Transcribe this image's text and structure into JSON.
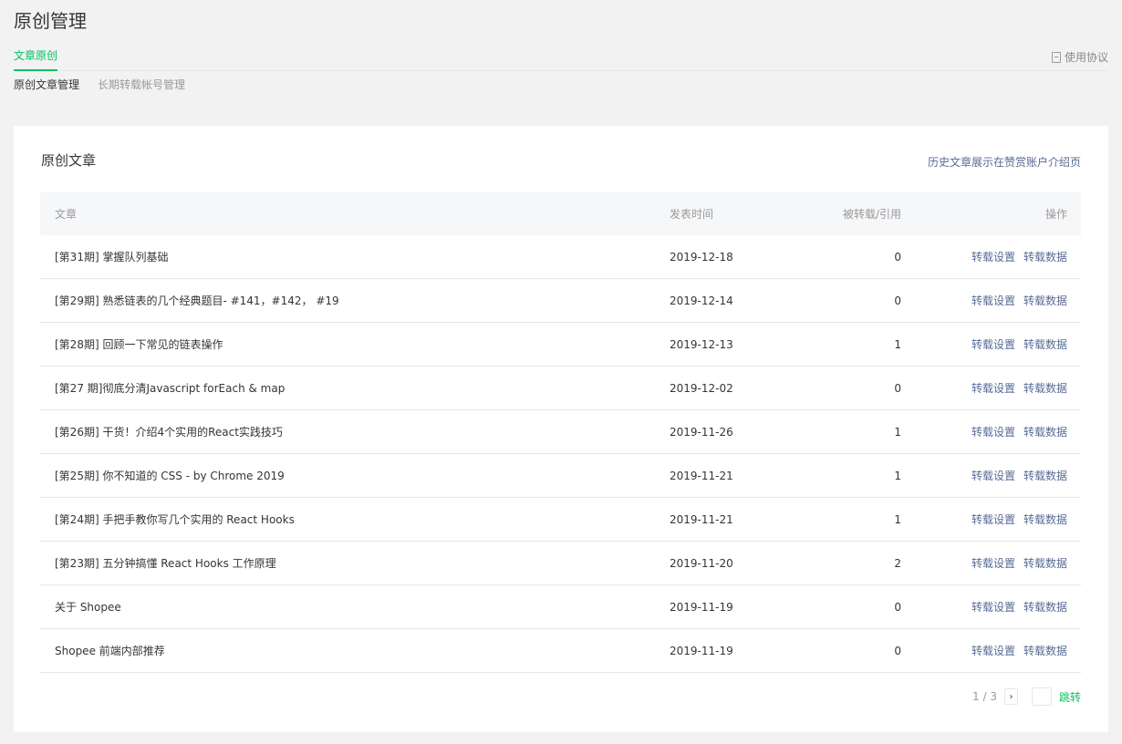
{
  "page": {
    "title": "原创管理"
  },
  "tabs": {
    "active": "文章原创",
    "agreement_link": "使用协议",
    "agreement_icon": "document-icon"
  },
  "subtabs": [
    {
      "label": "原创文章管理",
      "active": true
    },
    {
      "label": "长期转载帐号管理",
      "active": false
    }
  ],
  "card": {
    "title": "原创文章",
    "link": "历史文章展示在赞赏账户介绍页"
  },
  "table": {
    "headers": {
      "title": "文章",
      "date": "发表时间",
      "count": "被转载/引用",
      "ops": "操作"
    },
    "op_labels": {
      "settings": "转载设置",
      "data": "转载数据"
    },
    "rows": [
      {
        "title": "[第31期] 掌握队列基础",
        "date": "2019-12-18",
        "count": "0"
      },
      {
        "title": "[第29期] 熟悉链表的几个经典题目- #141，#142， #19",
        "date": "2019-12-14",
        "count": "0"
      },
      {
        "title": "[第28期] 回顾一下常见的链表操作",
        "date": "2019-12-13",
        "count": "1"
      },
      {
        "title": "[第27 期]彻底分清Javascript forEach & map",
        "date": "2019-12-02",
        "count": "0"
      },
      {
        "title": "[第26期] 干货！介绍4个实用的React实践技巧",
        "date": "2019-11-26",
        "count": "1"
      },
      {
        "title": "[第25期] 你不知道的 CSS - by Chrome 2019",
        "date": "2019-11-21",
        "count": "1"
      },
      {
        "title": "[第24期] 手把手教你写几个实用的 React Hooks",
        "date": "2019-11-21",
        "count": "1"
      },
      {
        "title": "[第23期] 五分钟搞懂 React Hooks 工作原理",
        "date": "2019-11-20",
        "count": "2"
      },
      {
        "title": "关于 Shopee",
        "date": "2019-11-19",
        "count": "0"
      },
      {
        "title": "Shopee 前端内部推荐",
        "date": "2019-11-19",
        "count": "0"
      }
    ]
  },
  "pager": {
    "count": "1 / 3",
    "next_icon": "chevron-right-icon",
    "input_value": "",
    "jump_label": "跳转"
  },
  "colors": {
    "accent": "#07c160",
    "link": "#576b95",
    "background": "#f2f2f2"
  }
}
